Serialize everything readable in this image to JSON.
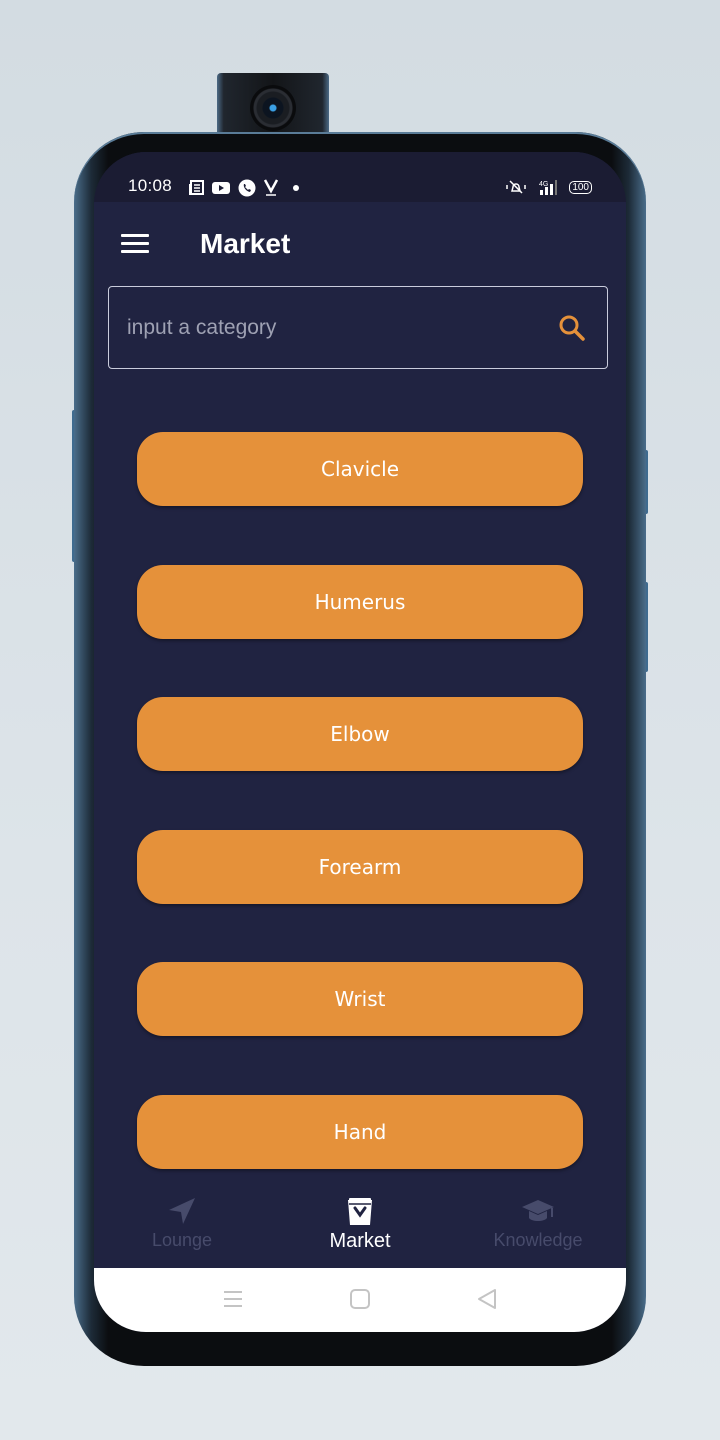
{
  "status_bar": {
    "time": "10:08",
    "left_icons": [
      "news-icon",
      "youtube-icon",
      "whatsapp-icon",
      "v-app-icon",
      "dot-icon"
    ],
    "right_icons": [
      "mute-vibrate-icon",
      "signal-4g-icon",
      "battery-icon"
    ],
    "network": "4G",
    "battery": "100"
  },
  "app_bar": {
    "title": "Market",
    "menu_icon": "hamburger-icon"
  },
  "search": {
    "placeholder": "input a category",
    "value": "",
    "icon": "search-icon"
  },
  "categories": [
    {
      "label": "Clavicle"
    },
    {
      "label": "Humerus"
    },
    {
      "label": "Elbow"
    },
    {
      "label": "Forearm"
    },
    {
      "label": "Wrist"
    },
    {
      "label": "Hand"
    }
  ],
  "bottom_nav": {
    "items": [
      {
        "label": "Lounge",
        "icon": "send-icon",
        "active": false
      },
      {
        "label": "Market",
        "icon": "shopping-bag-icon",
        "active": true
      },
      {
        "label": "Knowledge",
        "icon": "graduation-cap-icon",
        "active": false
      }
    ]
  },
  "system_nav": [
    "recents-icon",
    "home-icon",
    "back-icon"
  ],
  "colors": {
    "background": "#202341",
    "accent": "#e5913a",
    "inactive": "#474b6b",
    "text": "#ffffff"
  }
}
